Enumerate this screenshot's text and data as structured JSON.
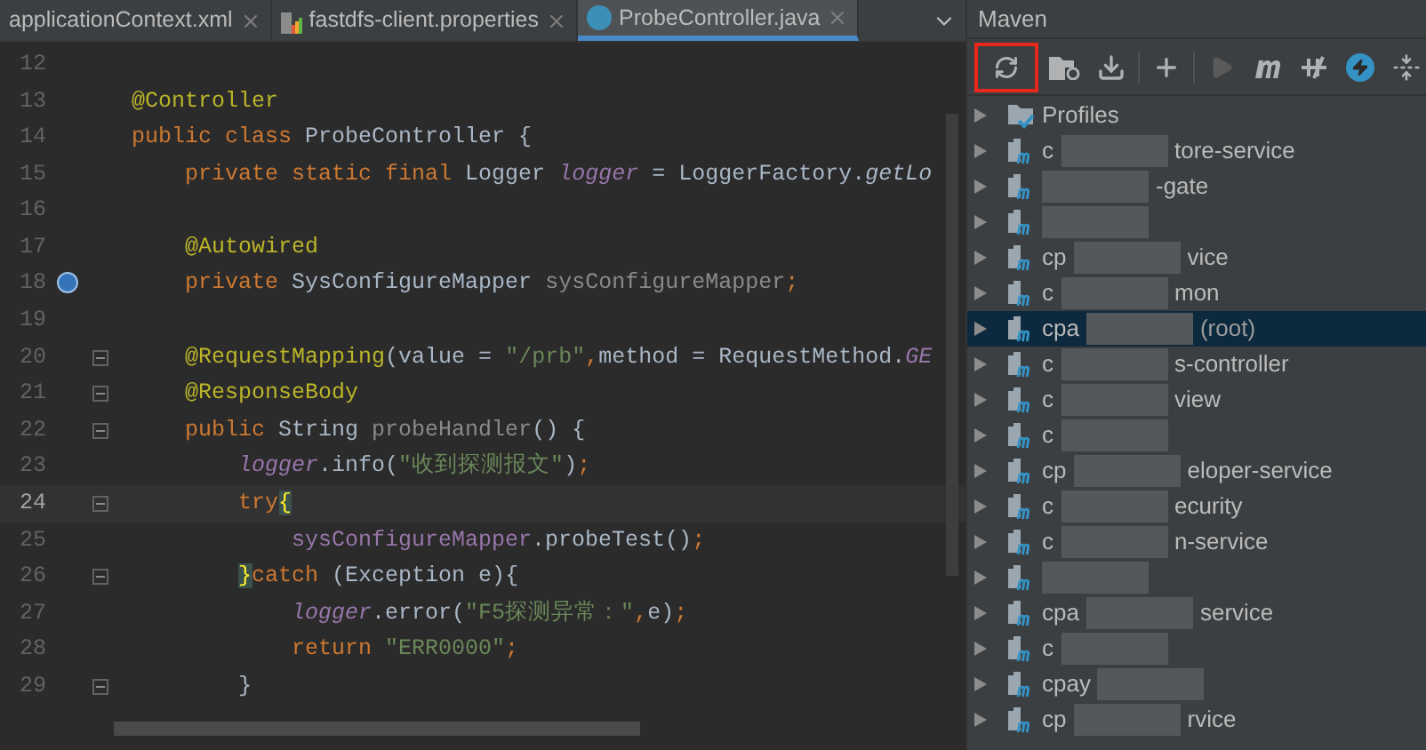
{
  "editor_tabs": [
    {
      "label": "applicationContext.xml",
      "kind": "xml",
      "selected": false
    },
    {
      "label": "fastdfs-client.properties",
      "kind": "properties",
      "selected": false
    },
    {
      "label": "ProbeController.java",
      "kind": "java",
      "selected": true
    }
  ],
  "code": {
    "lines": [
      {
        "number": "12",
        "current": false,
        "fold": false,
        "bean_marker": false
      },
      {
        "number": "13",
        "current": false,
        "fold": false,
        "bean_marker": false,
        "tokens": [
          {
            "kind": "ann",
            "text": "@Controller"
          }
        ]
      },
      {
        "number": "14",
        "current": false,
        "fold": false,
        "bean_marker": false,
        "tokens": [
          {
            "kind": "kw",
            "text": "public class "
          },
          {
            "kind": "plain",
            "text": "ProbeController {"
          }
        ]
      },
      {
        "number": "15",
        "current": false,
        "fold": false,
        "bean_marker": false,
        "tokens": [
          {
            "kind": "kw",
            "text": "    private static final "
          },
          {
            "kind": "plain",
            "text": "Logger "
          },
          {
            "kind": "field_italic",
            "text": "logger"
          },
          {
            "kind": "plain",
            "text": " = LoggerFactory."
          },
          {
            "kind": "call_italic",
            "text": "getLo"
          }
        ]
      },
      {
        "number": "16",
        "current": false,
        "fold": false,
        "bean_marker": false
      },
      {
        "number": "17",
        "current": false,
        "fold": false,
        "bean_marker": false,
        "tokens": [
          {
            "kind": "ann",
            "text": "    @Autowired"
          }
        ]
      },
      {
        "number": "18",
        "current": false,
        "fold": false,
        "bean_marker": true,
        "tokens": [
          {
            "kind": "kw",
            "text": "    private "
          },
          {
            "kind": "plain",
            "text": "SysConfigureMapper "
          },
          {
            "kind": "muted",
            "text": "sysConfigureMapper"
          },
          {
            "kind": "kw",
            "text": ";"
          }
        ]
      },
      {
        "number": "19",
        "current": false,
        "fold": false,
        "bean_marker": false
      },
      {
        "number": "20",
        "current": false,
        "fold": true,
        "bean_marker": false,
        "tokens": [
          {
            "kind": "ann",
            "text": "    @RequestMapping"
          },
          {
            "kind": "plain",
            "text": "(value = "
          },
          {
            "kind": "str",
            "text": "\"/prb\""
          },
          {
            "kind": "kw",
            "text": ","
          },
          {
            "kind": "plain",
            "text": "method = RequestMethod."
          },
          {
            "kind": "field_italic",
            "text": "GE"
          }
        ]
      },
      {
        "number": "21",
        "current": false,
        "fold": true,
        "bean_marker": false,
        "tokens": [
          {
            "kind": "ann",
            "text": "    @ResponseBody"
          }
        ]
      },
      {
        "number": "22",
        "current": false,
        "fold": true,
        "bean_marker": false,
        "tokens": [
          {
            "kind": "kw",
            "text": "    public "
          },
          {
            "kind": "plain",
            "text": "String "
          },
          {
            "kind": "muted",
            "text": "probeHandler"
          },
          {
            "kind": "plain",
            "text": "() {"
          }
        ]
      },
      {
        "number": "23",
        "current": false,
        "fold": false,
        "bean_marker": false,
        "tokens": [
          {
            "kind": "field_italic",
            "text": "        logger"
          },
          {
            "kind": "plain",
            "text": ".info("
          },
          {
            "kind": "str",
            "text": "\"收到探测报文\""
          },
          {
            "kind": "plain",
            "text": ")"
          },
          {
            "kind": "kw",
            "text": ";"
          }
        ]
      },
      {
        "number": "24",
        "current": true,
        "fold": true,
        "bean_marker": false,
        "tokens": [
          {
            "kind": "kw",
            "text": "        try"
          },
          {
            "kind": "brace",
            "text": "{"
          }
        ]
      },
      {
        "number": "25",
        "current": false,
        "fold": false,
        "bean_marker": false,
        "tokens": [
          {
            "kind": "field",
            "text": "            sysConfigureMapper"
          },
          {
            "kind": "plain",
            "text": ".probeTest()"
          },
          {
            "kind": "kw",
            "text": ";"
          }
        ]
      },
      {
        "number": "26",
        "current": false,
        "fold": true,
        "bean_marker": false,
        "tokens": [
          {
            "kind": "brace",
            "text": "        }"
          },
          {
            "kind": "kw",
            "text": "catch "
          },
          {
            "kind": "plain",
            "text": "(Exception e){"
          }
        ]
      },
      {
        "number": "27",
        "current": false,
        "fold": false,
        "bean_marker": false,
        "tokens": [
          {
            "kind": "field_italic",
            "text": "            logger"
          },
          {
            "kind": "plain",
            "text": ".error("
          },
          {
            "kind": "str",
            "text": "\"F5探测异常：\""
          },
          {
            "kind": "kw",
            "text": ","
          },
          {
            "kind": "plain",
            "text": "e)"
          },
          {
            "kind": "kw",
            "text": ";"
          }
        ]
      },
      {
        "number": "28",
        "current": false,
        "fold": false,
        "bean_marker": false,
        "tokens": [
          {
            "kind": "kw",
            "text": "            return "
          },
          {
            "kind": "str",
            "text": "\"ERR0000\""
          },
          {
            "kind": "kw",
            "text": ";"
          }
        ]
      },
      {
        "number": "29",
        "current": false,
        "fold": true,
        "bean_marker": false,
        "tokens": [
          {
            "kind": "plain",
            "text": "        }"
          }
        ]
      }
    ]
  },
  "maven": {
    "title": "Maven",
    "toolbar": [
      {
        "kind": "reload",
        "highlighted": true,
        "disabled": false
      },
      {
        "kind": "folder_reload",
        "highlighted": false,
        "disabled": false
      },
      {
        "kind": "download",
        "highlighted": false,
        "disabled": false
      },
      {
        "kind": "separator"
      },
      {
        "kind": "plus",
        "highlighted": false,
        "disabled": false
      },
      {
        "kind": "separator"
      },
      {
        "kind": "run",
        "highlighted": false,
        "disabled": true
      },
      {
        "kind": "m",
        "highlighted": false,
        "disabled": false
      },
      {
        "kind": "skip_tests",
        "highlighted": false,
        "disabled": false
      },
      {
        "kind": "offline",
        "highlighted": false,
        "disabled": false
      },
      {
        "kind": "collapse",
        "highlighted": false,
        "disabled": false
      }
    ],
    "tree": [
      {
        "kind": "profiles",
        "label": "Profiles",
        "selected": false
      },
      {
        "kind": "module",
        "prefix": "c",
        "suffix": "tore-service",
        "selected": false
      },
      {
        "kind": "module",
        "suffix": "-gate",
        "selected": false
      },
      {
        "kind": "module",
        "selected": false
      },
      {
        "kind": "module",
        "prefix": "cp",
        "suffix": "vice",
        "selected": false
      },
      {
        "kind": "module",
        "prefix": "c",
        "suffix": "mon",
        "selected": false
      },
      {
        "kind": "module",
        "prefix": "cpa",
        "suffix": "(root)",
        "selected": true
      },
      {
        "kind": "module",
        "prefix": "c",
        "suffix": "s-controller",
        "selected": false
      },
      {
        "kind": "module",
        "prefix": "c",
        "suffix": "view",
        "selected": false
      },
      {
        "kind": "module",
        "prefix": "c",
        "selected": false
      },
      {
        "kind": "module",
        "prefix": "cp",
        "suffix": "eloper-service",
        "selected": false
      },
      {
        "kind": "module",
        "prefix": "c",
        "suffix": "ecurity",
        "selected": false
      },
      {
        "kind": "module",
        "prefix": "c",
        "suffix": "n-service",
        "selected": false
      },
      {
        "kind": "module",
        "selected": false
      },
      {
        "kind": "module",
        "prefix": "cpa",
        "suffix": "service",
        "selected": false
      },
      {
        "kind": "module",
        "prefix": "c",
        "selected": false
      },
      {
        "kind": "module",
        "prefix": "cpay",
        "selected": false
      },
      {
        "kind": "module",
        "prefix": "cp",
        "suffix": "rvice",
        "selected": false
      }
    ]
  }
}
